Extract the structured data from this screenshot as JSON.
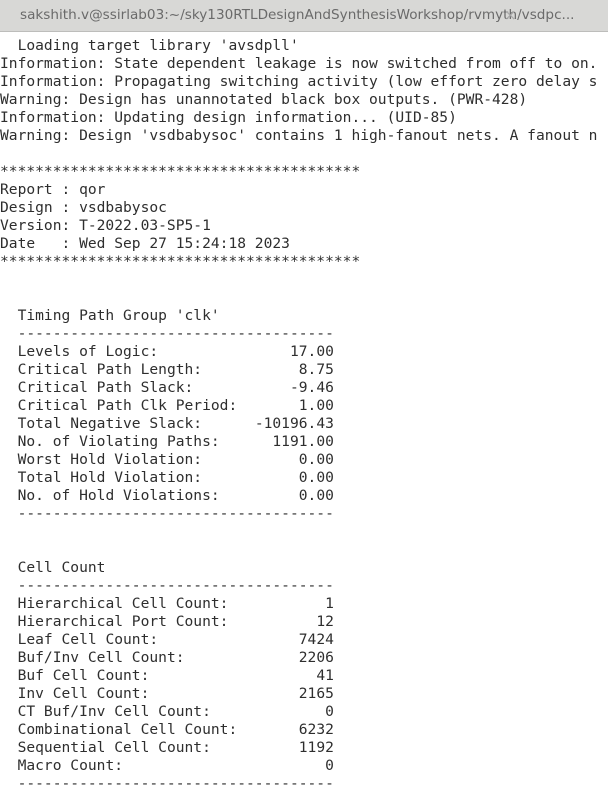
{
  "window": {
    "title": "sakshith.v@ssirlab03:~/sky130RTLDesignAndSynthesisWorkshop/rvmyth/vsdpc...",
    "close_icon": "×"
  },
  "log": [
    "  Loading target library 'avsdpll'",
    "Information: State dependent leakage is now switched from off to on.",
    "Information: Propagating switching activity (low effort zero delay s",
    "Warning: Design has unannotated black box outputs. (PWR-428)",
    "Information: Updating design information... (UID-85)",
    "Warning: Design 'vsdbabysoc' contains 1 high-fanout nets. A fanout n"
  ],
  "report_header": {
    "stars": "*****************************************",
    "report": "Report : qor",
    "design": "Design : vsdbabysoc",
    "version": "Version: T-2022.03-SP5-1",
    "date": "Date   : Wed Sep 27 15:24:18 2023"
  },
  "separator": "  ------------------------------------",
  "timing": {
    "title": "  Timing Path Group 'clk'",
    "rows": [
      {
        "label": "Levels of Logic:",
        "value": "17.00"
      },
      {
        "label": "Critical Path Length:",
        "value": "8.75"
      },
      {
        "label": "Critical Path Slack:",
        "value": "-9.46"
      },
      {
        "label": "Critical Path Clk Period:",
        "value": "1.00"
      },
      {
        "label": "Total Negative Slack:",
        "value": "-10196.43"
      },
      {
        "label": "No. of Violating Paths:",
        "value": "1191.00"
      },
      {
        "label": "Worst Hold Violation:",
        "value": "0.00"
      },
      {
        "label": "Total Hold Violation:",
        "value": "0.00"
      },
      {
        "label": "No. of Hold Violations:",
        "value": "0.00"
      }
    ]
  },
  "cells": {
    "title": "  Cell Count",
    "rows": [
      {
        "label": "Hierarchical Cell Count:",
        "value": "1"
      },
      {
        "label": "Hierarchical Port Count:",
        "value": "12"
      },
      {
        "label": "Leaf Cell Count:",
        "value": "7424"
      },
      {
        "label": "Buf/Inv Cell Count:",
        "value": "2206"
      },
      {
        "label": "Buf Cell Count:",
        "value": "41"
      },
      {
        "label": "Inv Cell Count:",
        "value": "2165"
      },
      {
        "label": "CT Buf/Inv Cell Count:",
        "value": "0"
      },
      {
        "label": "Combinational Cell Count:",
        "value": "6232"
      },
      {
        "label": "Sequential Cell Count:",
        "value": "1192"
      },
      {
        "label": "Macro Count:",
        "value": "0"
      }
    ]
  }
}
